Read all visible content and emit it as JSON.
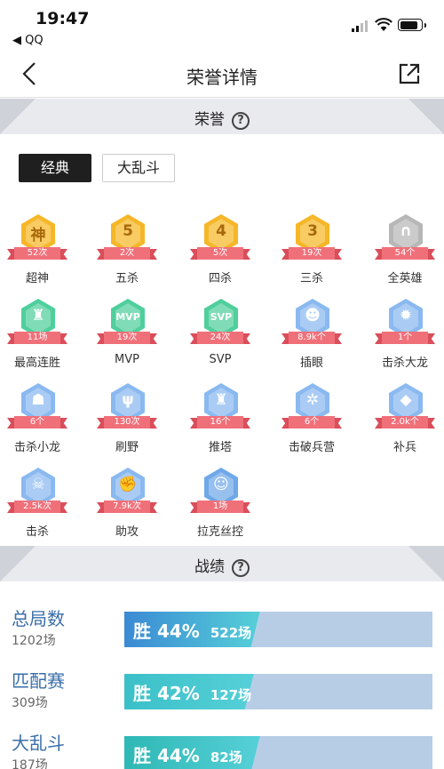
{
  "status_bar": {
    "time": "19:47",
    "back_app": "◀ QQ"
  },
  "nav": {
    "title": "荣誉详情"
  },
  "honor_section": {
    "title": "荣誉",
    "help": "?"
  },
  "tabs": [
    {
      "label": "经典",
      "active": true
    },
    {
      "label": "大乱斗",
      "active": false
    }
  ],
  "badges": [
    {
      "name": "超神",
      "count": "52次",
      "glyph": "神",
      "color": "#f5b728"
    },
    {
      "name": "五杀",
      "count": "2次",
      "glyph": "5",
      "color": "#f5b728"
    },
    {
      "name": "四杀",
      "count": "5次",
      "glyph": "4",
      "color": "#f5b728"
    },
    {
      "name": "三杀",
      "count": "19次",
      "glyph": "3",
      "color": "#f5b728"
    },
    {
      "name": "全英雄",
      "count": "54个",
      "glyph": "∩",
      "color": "#b7b7b7"
    },
    {
      "name": "最高连胜",
      "count": "11场",
      "glyph": "♜",
      "color": "#4fcf9c"
    },
    {
      "name": "MVP",
      "count": "19次",
      "glyph": "MVP",
      "color": "#4fcf9c"
    },
    {
      "name": "SVP",
      "count": "24次",
      "glyph": "SVP",
      "color": "#4fcf9c"
    },
    {
      "name": "插眼",
      "count": "8.9k个",
      "glyph": "☻",
      "color": "#8ab9f0"
    },
    {
      "name": "击杀大龙",
      "count": "1个",
      "glyph": "✹",
      "color": "#8ab9f0"
    },
    {
      "name": "击杀小龙",
      "count": "6个",
      "glyph": "☗",
      "color": "#8ab9f0"
    },
    {
      "name": "刷野",
      "count": "130次",
      "glyph": "ψ",
      "color": "#8ab9f0"
    },
    {
      "name": "推塔",
      "count": "16个",
      "glyph": "♜",
      "color": "#8ab9f0"
    },
    {
      "name": "击破兵营",
      "count": "6个",
      "glyph": "✲",
      "color": "#8ab9f0"
    },
    {
      "name": "补兵",
      "count": "2.0k个",
      "glyph": "◆",
      "color": "#8ab9f0"
    },
    {
      "name": "击杀",
      "count": "2.5k次",
      "glyph": "☠",
      "color": "#8ab9f0"
    },
    {
      "name": "助攻",
      "count": "7.9k次",
      "glyph": "✊",
      "color": "#8ab9f0"
    },
    {
      "name": "拉克丝控",
      "count": "1场",
      "glyph": "☺",
      "color": "#6fa8e8"
    }
  ],
  "record_section": {
    "title": "战绩",
    "help": "?"
  },
  "stats": [
    {
      "label": "总局数",
      "games": "1202场",
      "win_text": "胜 44%",
      "win_games": "522场",
      "win_rate": 0.44,
      "fill": "#3b8ad4"
    },
    {
      "label": "匹配赛",
      "games": "309场",
      "win_text": "胜 42%",
      "win_games": "127场",
      "win_rate": 0.42,
      "fill": "#3bc0c8"
    },
    {
      "label": "大乱斗",
      "games": "187场",
      "win_text": "胜 44%",
      "win_games": "82场",
      "win_rate": 0.44,
      "fill": "#2eb8b4"
    }
  ]
}
